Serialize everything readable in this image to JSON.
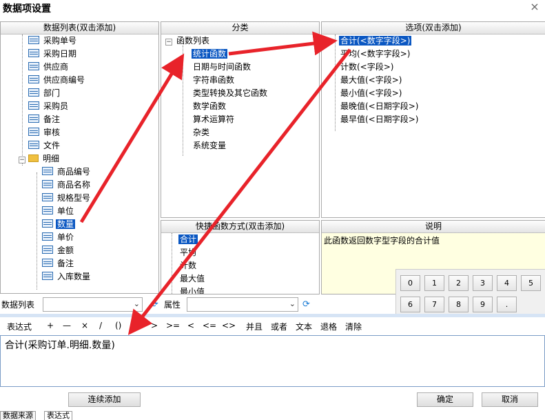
{
  "window": {
    "title": "数据项设置",
    "close": "×"
  },
  "data_list": {
    "header": "数据列表(双击添加)",
    "items": [
      "采购单号",
      "采购日期",
      "供应商",
      "供应商编号",
      "部门",
      "采购员",
      "备注",
      "审核",
      "文件"
    ],
    "folder": "明细",
    "children": [
      "商品编号",
      "商品名称",
      "规格型号",
      "单位",
      "数量",
      "单价",
      "金额",
      "备注",
      "入库数量"
    ],
    "selected": "数量"
  },
  "category": {
    "header": "分类",
    "root": "函数列表",
    "items": [
      "统计函数",
      "日期与时间函数",
      "字符串函数",
      "类型转换及其它函数",
      "数学函数",
      "算术运算符",
      "杂类",
      "系统变量"
    ],
    "selected": "统计函数"
  },
  "options": {
    "header": "选项(双击添加)",
    "items": [
      "合计(<数字字段>)",
      "平均(<数字字段>)",
      "计数(<字段>)",
      "最大值(<字段>)",
      "最小值(<字段>)",
      "最晚值(<日期字段>)",
      "最早值(<日期字段>)"
    ],
    "selected": "合计(<数字字段>)"
  },
  "quick": {
    "header": "快捷函数方式(双击添加)",
    "items": [
      "合计",
      "平均",
      "计数",
      "最大值",
      "最小值"
    ],
    "selected": "合计"
  },
  "description": {
    "header": "说明",
    "text": "此函数返回数字型字段的合计值"
  },
  "numpad": [
    "0",
    "1",
    "2",
    "3",
    "4",
    "5",
    "6",
    "7",
    "8",
    "9",
    "."
  ],
  "filters": {
    "data_list_label": "数据列表",
    "property_label": "属性",
    "data_list_value": "",
    "property_value": ""
  },
  "operators": {
    "label": "表达式",
    "items": [
      "+",
      "—",
      "×",
      "/",
      "()",
      ">",
      ">=",
      "<",
      "<=",
      "<>",
      "并且",
      "或者",
      "文本",
      "退格",
      "清除"
    ]
  },
  "expression": "合计(采购订单.明细.数量)",
  "buttons": {
    "continuous_add": "连续添加",
    "ok": "确定",
    "cancel": "取消"
  },
  "tabs": [
    "数据来源",
    "表达式"
  ],
  "colors": {
    "selection": "#0a57c2",
    "annotation_arrow": "#e8232a",
    "description_bg": "#ffffe1"
  }
}
